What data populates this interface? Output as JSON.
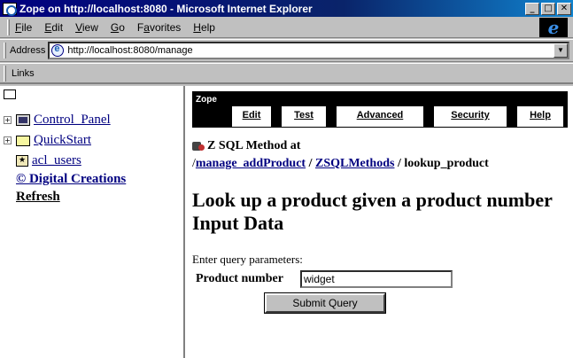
{
  "window": {
    "title": "Zope on http://localhost:8080 - Microsoft Internet Explorer",
    "controls": {
      "minimize": "_",
      "maximize": "□",
      "close": "✕"
    }
  },
  "menubar": {
    "items": [
      {
        "label": "File",
        "accel": "F",
        "rest": "ile"
      },
      {
        "label": "Edit",
        "accel": "E",
        "rest": "dit"
      },
      {
        "label": "View",
        "accel": "V",
        "rest": "iew"
      },
      {
        "label": "Go",
        "accel": "G",
        "rest": "o"
      },
      {
        "label": "Favorites",
        "accel": "a",
        "pre": "F",
        "rest": "vorites"
      },
      {
        "label": "Help",
        "accel": "H",
        "rest": "elp"
      }
    ],
    "logo": "e"
  },
  "addressbar": {
    "label": "Address",
    "url": "http://localhost:8080/manage"
  },
  "linksbar": {
    "label": "Links"
  },
  "tree": {
    "items": [
      {
        "label": "Control_Panel",
        "expander": "+",
        "icon": "control-panel-icon"
      },
      {
        "label": "QuickStart",
        "expander": "+",
        "icon": "folder-icon"
      },
      {
        "label": "acl_users",
        "icon": "user-folder-icon"
      },
      {
        "label": "© Digital Creations"
      },
      {
        "label": "Refresh"
      }
    ]
  },
  "manage": {
    "logo": "Zope",
    "tabs": [
      "Edit",
      "Test",
      "Advanced",
      "Security",
      "Help"
    ],
    "object_type": "Z SQL Method at",
    "path_prefix": "/",
    "path_links": [
      "manage_addProduct",
      "ZSQLMethods"
    ],
    "path_sep": " / ",
    "path_current": "lookup_product",
    "heading": "Look up a product given a product number Input Data",
    "enter_label": "Enter query parameters:",
    "field_label": "Product number",
    "field_value": "widget",
    "submit_label": "Submit Query"
  }
}
